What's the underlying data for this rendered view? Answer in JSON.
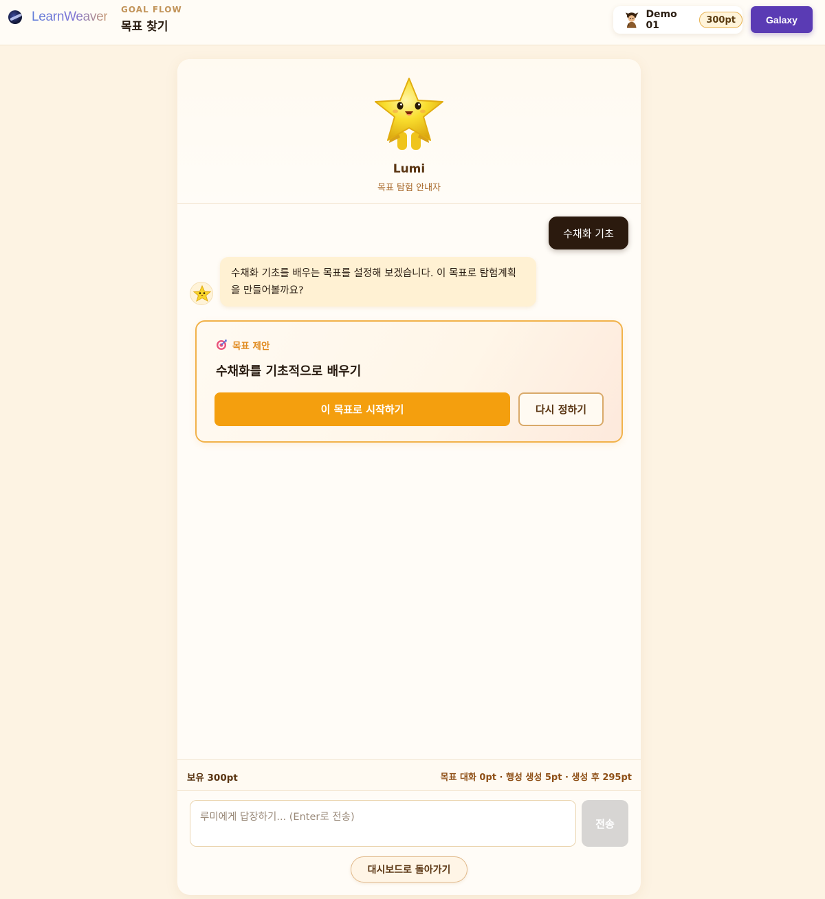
{
  "header": {
    "brand": "LearnWeaver",
    "flow_label": "GOAL FLOW",
    "flow_title": "목표 찾기",
    "user_name": "Demo 01",
    "user_points": "300pt",
    "galaxy_button": "Galaxy"
  },
  "guide": {
    "name": "Lumi",
    "role": "목표 탐험 안내자"
  },
  "chat": {
    "user_message": "수채화 기초",
    "bot_message": "수채화 기초를 배우는 목표를 설정해 보겠습니다. 이 목표로 탐험계획을 만들어볼까요?"
  },
  "goal_suggestion": {
    "tag_label": "목표 제안",
    "title": "수채화를 기초적으로 배우기",
    "start_button": "이 목표로 시작하기",
    "retry_button": "다시 정하기"
  },
  "points": {
    "owned": "보유 300pt",
    "cost_summary": "목표 대화 0pt · 행성 생성 5pt · 생성 후 295pt"
  },
  "composer": {
    "placeholder": "루미에게 답장하기... (Enter로 전송)",
    "value": "",
    "send_button": "전송",
    "back_button": "대시보드로 돌아가기"
  },
  "colors": {
    "page_bg": "#fdf3e3",
    "accent_orange": "#f49f0e",
    "galaxy_purple": "#5a3bb4",
    "user_bubble": "#2b1a0e",
    "bot_bubble": "#fff1d3",
    "send_disabled": "#d7d5d3"
  },
  "icons": {
    "brand": "planet-logo-icon",
    "user_avatar": "character-avatar-icon",
    "mascot": "star-mascot-icon",
    "goal_tag": "target-icon"
  }
}
